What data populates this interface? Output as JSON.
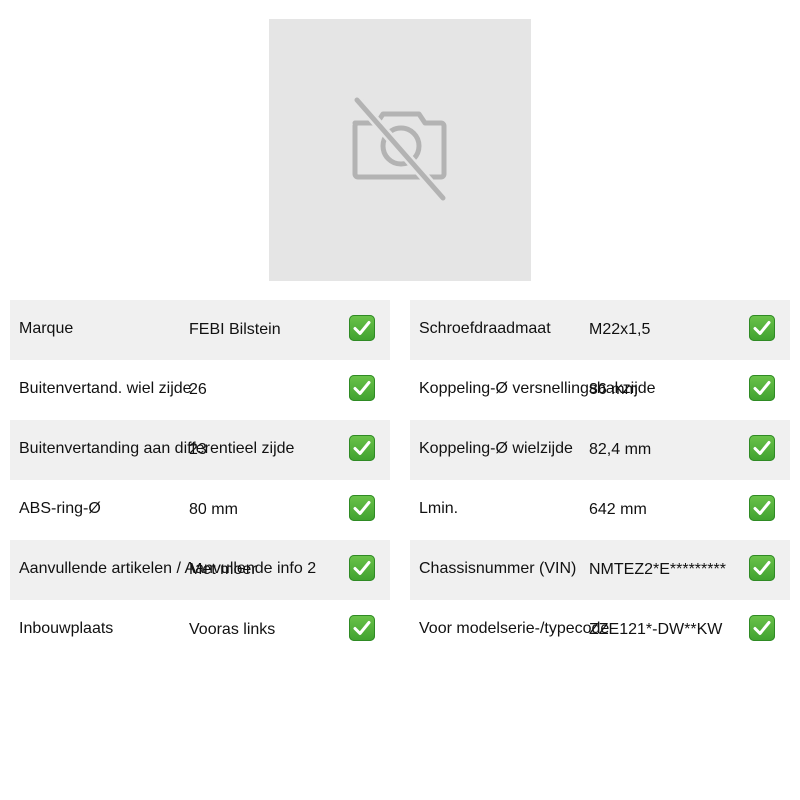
{
  "product_image": {
    "icon": "no-image-icon",
    "placeholder_color": "#e5e5e5"
  },
  "specs_left": [
    {
      "label": "Marque",
      "value": "FEBI Bilstein",
      "check_icon": "check-icon"
    },
    {
      "label": "Buitenvertand. wiel zijde",
      "value": "26",
      "check_icon": "check-icon"
    },
    {
      "label": "Buitenvertanding aan differentieel zijde",
      "value": "23",
      "check_icon": "check-icon"
    },
    {
      "label": "ABS-ring-Ø",
      "value": "80 mm",
      "check_icon": "check-icon"
    },
    {
      "label": "Aanvullende artikelen / Aanvullende info 2",
      "value": "Met moer",
      "check_icon": "check-icon"
    },
    {
      "label": "Inbouwplaats",
      "value": "Vooras links",
      "check_icon": "check-icon"
    }
  ],
  "specs_right": [
    {
      "label": "Schroefdraadmaat",
      "value": "M22x1,5",
      "check_icon": "check-icon"
    },
    {
      "label": "Koppeling-Ø versnellingsbakzijde",
      "value": "86 mm",
      "check_icon": "check-icon"
    },
    {
      "label": "Koppeling-Ø wielzijde",
      "value": "82,4 mm",
      "check_icon": "check-icon"
    },
    {
      "label": "Lmin.",
      "value": "642 mm",
      "check_icon": "check-icon"
    },
    {
      "label": "Chassisnummer (VIN)",
      "value": "NMTEZ2*E*********",
      "check_icon": "check-icon"
    },
    {
      "label": "Voor modelserie-/typecode",
      "value": "ZZE121*-DW**KW",
      "check_icon": "check-icon"
    }
  ],
  "colors": {
    "row_shade": "#f0f0f0",
    "check_green": "#3fa12f"
  }
}
